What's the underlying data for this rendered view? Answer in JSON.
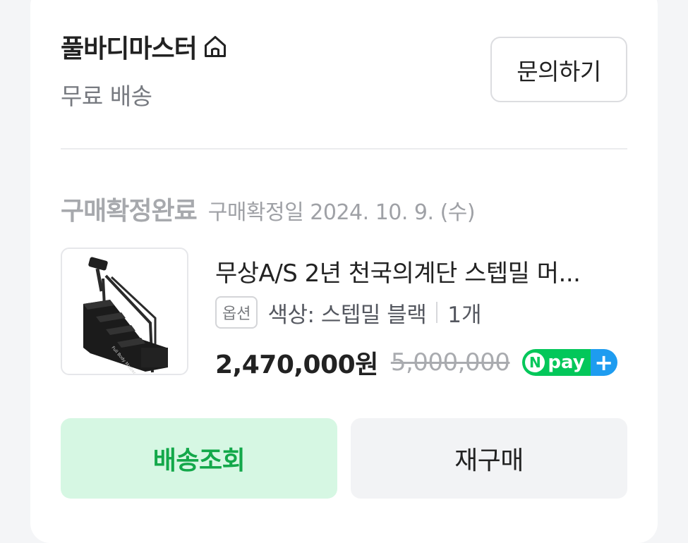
{
  "store": {
    "name": "풀바디마스터",
    "shipping": "무료 배송",
    "inquiry_label": "문의하기",
    "home_icon": "home-icon"
  },
  "order": {
    "status": "구매확정완료",
    "confirm_date": "구매확정일 2024. 10. 9. (수)"
  },
  "product": {
    "title": "무상A/S 2년 천국의계단 스텝밀 머...",
    "option_badge": "옵션",
    "option_text": "색상: 스텝밀 블랙",
    "quantity": "1개",
    "price": "2,470,000원",
    "original_price": "5,000,000",
    "pay_badge": {
      "n": "N",
      "text": "pay",
      "plus": "+",
      "green": "#03c75a",
      "blue": "#1e9cf0"
    }
  },
  "actions": {
    "track_label": "배송조회",
    "reorder_label": "재구매"
  },
  "colors": {
    "track_bg": "#d6f7e3",
    "track_text": "#13a84a",
    "reorder_bg": "#f2f3f5"
  }
}
